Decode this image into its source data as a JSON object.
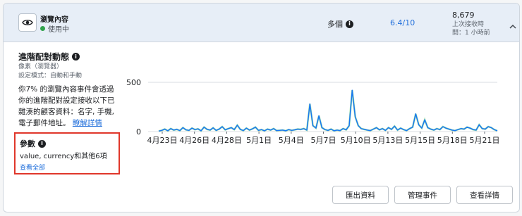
{
  "header": {
    "event_name": "瀏覽內容",
    "event_status": "使用中",
    "sources": "多個",
    "match_score": "6.4/10",
    "event_count": "8,679",
    "last_received_label": "上次接收時",
    "last_received_value": "間：1 小時前"
  },
  "panel": {
    "title": "進階配對動態",
    "subtitle": "像素（瀏覽器）",
    "setup_mode": "設定模式：自動和手動",
    "description": "你7% 的瀏覽內容事件會透過你的進階配對設定接收以下已雜湊的顧客資料：名字, 手機, 電子郵件地址。",
    "learn_more": "瞭解詳情"
  },
  "parameters": {
    "title": "參數",
    "values": "value, currency和其他6項",
    "see_all": "查看全部"
  },
  "buttons": {
    "export": "匯出資料",
    "manage_events": "管理事件",
    "view_details": "查看詳情"
  },
  "colors": {
    "line": "#1877f2",
    "highlight_line": "#6bcf72",
    "annotation_border": "#e0372b",
    "link": "#216fdb"
  },
  "chart_data": {
    "type": "line",
    "y_ticks": [
      0,
      500
    ],
    "ylim": [
      0,
      600
    ],
    "x_tick_labels": [
      "4月23日",
      "4月26日",
      "4月28日",
      "5月1日",
      "5月4日",
      "5月7日",
      "5月10日",
      "5月13日",
      "5月15日",
      "5月18日",
      "5月21日"
    ],
    "series": [
      {
        "values": [
          5,
          12,
          25,
          8,
          30,
          15,
          22,
          10,
          40,
          18,
          12,
          35,
          20,
          28,
          8,
          45,
          22,
          15,
          38,
          12,
          25,
          50,
          18,
          30,
          40,
          20,
          65,
          22,
          10,
          35,
          15,
          28,
          45,
          12,
          20,
          8,
          25,
          15,
          30,
          10,
          12,
          15,
          8,
          20,
          12,
          18,
          25,
          22,
          30,
          15,
          280,
          60,
          35,
          160,
          40,
          20,
          12,
          25,
          8,
          15,
          10,
          30,
          18,
          60,
          420,
          150,
          60,
          30,
          22,
          15,
          10,
          25,
          40,
          18,
          30,
          12,
          40,
          22,
          55,
          15,
          35,
          20,
          10,
          30,
          45,
          180,
          70,
          35,
          120,
          40,
          25,
          15,
          30,
          20,
          50,
          35,
          25,
          15,
          10,
          20,
          30,
          25,
          45,
          35,
          20,
          15,
          70,
          30,
          25,
          50,
          40,
          20,
          8
        ]
      }
    ]
  }
}
